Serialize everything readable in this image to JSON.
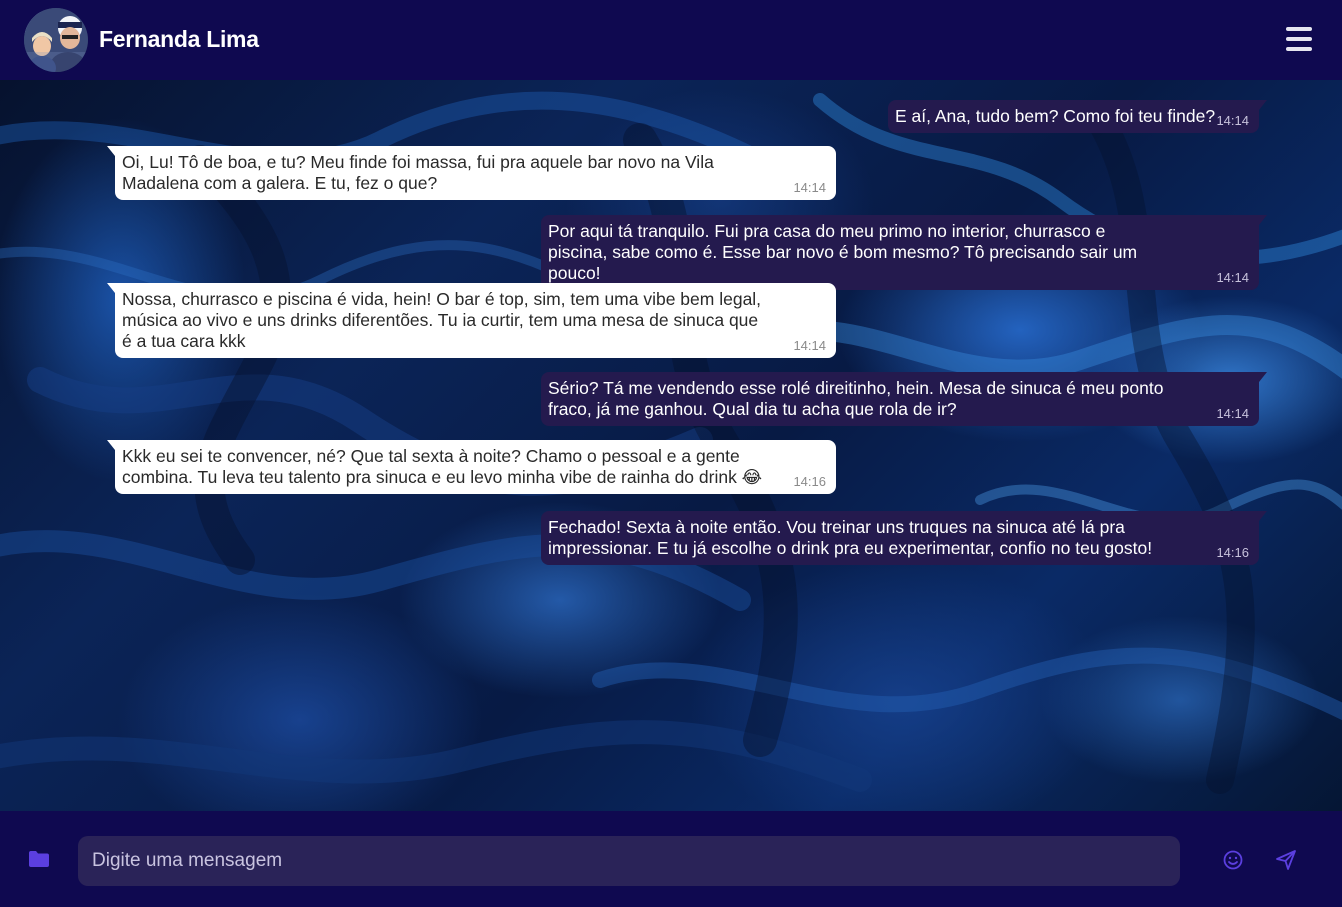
{
  "header": {
    "contact_name": "Fernanda Lima",
    "avatar_icon": "contact-avatar",
    "menu_icon": "hamburger-menu-icon"
  },
  "messages": [
    {
      "direction": "out",
      "text": "E aí, Ana, tudo bem? Como foi teu finde?",
      "time": "14:14"
    },
    {
      "direction": "in",
      "text": "Oi, Lu! Tô de boa, e tu? Meu finde foi massa, fui pra aquele bar novo na Vila Madalena com a galera. E tu, fez o que?",
      "time": "14:14"
    },
    {
      "direction": "out",
      "text": "Por aqui tá tranquilo. Fui pra casa do meu primo no interior, churrasco e piscina, sabe como é. Esse bar novo é bom mesmo? Tô precisando sair um pouco!",
      "time": "14:14"
    },
    {
      "direction": "in",
      "text": "Nossa, churrasco e piscina é vida, hein! O bar é top, sim, tem uma vibe bem legal, música ao vivo e uns drinks diferentões. Tu ia curtir, tem uma mesa de sinuca que é a tua cara kkk",
      "time": "14:14"
    },
    {
      "direction": "out",
      "text": "Sério? Tá me vendendo esse rolé direitinho, hein. Mesa de sinuca é meu ponto fraco, já me ganhou. Qual dia tu acha que rola de ir?",
      "time": "14:14"
    },
    {
      "direction": "in",
      "text": "Kkk eu sei te convencer, né? Que tal sexta à noite? Chamo o pessoal e a gente combina. Tu leva teu talento pra sinuca e eu levo minha vibe de rainha do drink 😂",
      "time": "14:16"
    },
    {
      "direction": "out",
      "text": "Fechado! Sexta à noite então. Vou treinar uns truques na sinuca até lá pra impressionar. E tu já escolhe o drink pra eu experimentar, confio no teu gosto!",
      "time": "14:16"
    }
  ],
  "composer": {
    "placeholder": "Digite uma mensagem",
    "value": "",
    "attach_icon": "folder-icon",
    "emoji_icon": "smiley-icon",
    "send_icon": "send-icon"
  },
  "colors": {
    "header_bg": "#0f0950",
    "outgoing_bubble": "#241a4e",
    "incoming_bubble": "#ffffff",
    "input_bg": "#2a2358",
    "icon_accent": "#5b3fe0"
  }
}
